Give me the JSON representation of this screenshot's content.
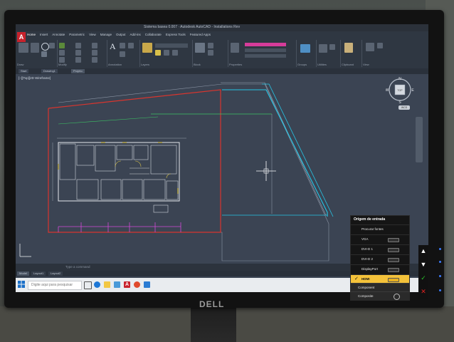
{
  "app": {
    "title": "Sistema basea 0.007 · Autodesk AutoCAD - Installations Rev",
    "logo_letter": "A",
    "ribbon_tabs": [
      "Home",
      "Insert",
      "Annotate",
      "Parametric",
      "View",
      "Manage",
      "Output",
      "Add-ins",
      "Collaborate",
      "Express Tools",
      "Featured Apps"
    ],
    "ribbon_panels": [
      {
        "label": "Draw"
      },
      {
        "label": "Modify"
      },
      {
        "label": "Annotation"
      },
      {
        "label": "Layers"
      },
      {
        "label": "Block"
      },
      {
        "label": "Properties"
      },
      {
        "label": "Groups"
      },
      {
        "label": "Utilities"
      },
      {
        "label": "Clipboard"
      },
      {
        "label": "View"
      }
    ],
    "doc_tabs": [
      "Start",
      "Drawing1",
      "Projeto"
    ],
    "view_label": "[−][Top][2D Wireframe]",
    "layout_tabs": [
      "Model",
      "Layout1",
      "Layout2"
    ],
    "command_placeholder": "Type a command",
    "viewcube": {
      "n": "N",
      "s": "S",
      "e": "E",
      "w": "W",
      "top": "TOP",
      "wcs": "WCS"
    }
  },
  "taskbar": {
    "search_placeholder": "Digite aqui para pesquisar"
  },
  "osd": {
    "title": "Origem de entrada",
    "items": [
      {
        "label": "Procurar fontes",
        "selected": false,
        "port": false
      },
      {
        "label": "VGA",
        "selected": false,
        "port": true
      },
      {
        "label": "DVI-D 1",
        "selected": false,
        "port": true
      },
      {
        "label": "DVI-D 2",
        "selected": false,
        "port": true
      },
      {
        "label": "DisplayPort",
        "selected": false,
        "port": true
      },
      {
        "label": "HDMI",
        "selected": true,
        "port": true
      }
    ],
    "bottom_items": [
      "Component",
      "Composite"
    ]
  },
  "monitor": {
    "brand": "DELL",
    "buttons": [
      "▲",
      "▼",
      "✓",
      "✕"
    ],
    "colors": {
      "up": "#ffffff",
      "down": "#ffffff",
      "ok": "#28c228",
      "cancel": "#e02020"
    }
  }
}
